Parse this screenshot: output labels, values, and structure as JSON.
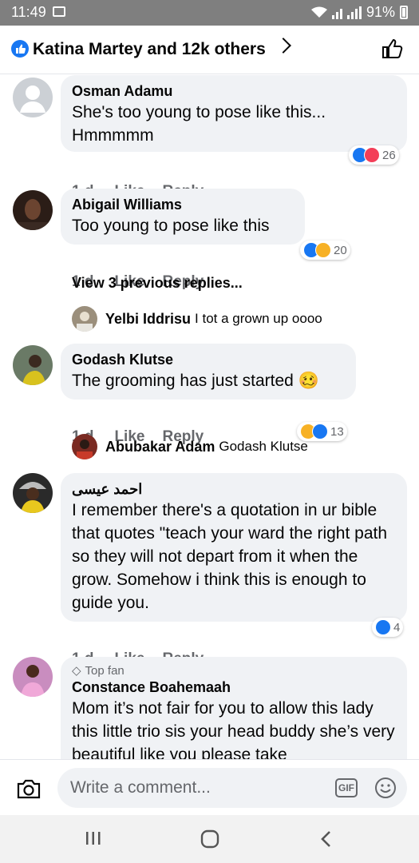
{
  "status": {
    "time": "11:49",
    "battery": "91%"
  },
  "header": {
    "title": "Katina Martey and 12k others"
  },
  "comments": [
    {
      "name": "Osman Adamu",
      "text": "She's too young to pose like this... Hmmmmm",
      "age": "1 d",
      "like": "Like",
      "reply": "Reply",
      "reactions": "26"
    },
    {
      "name": "Abigail Williams",
      "text": "Too young to pose like this",
      "age": "1 d",
      "like": "Like",
      "reply": "Reply",
      "reactions": "20"
    },
    {
      "name": "Godash Klutse",
      "text": "The grooming has just started 🥴",
      "age": "1 d",
      "like": "Like",
      "reply": "Reply",
      "reactions": "13"
    },
    {
      "name": "احمد عيسى",
      "text": "I remember there's a quotation in ur bible that quotes \"teach your ward the right path so they will not depart from it when the grow. Somehow i think this is enough to  guide you.",
      "age": "1 d",
      "like": "Like",
      "reply": "Reply",
      "reactions": "4"
    },
    {
      "badge": "Top fan",
      "name": "Constance Boahemaah",
      "text": "Mom it’s not fair for you to allow this lady this little trio sis your head buddy she’s very beautiful like you please take"
    }
  ],
  "view_previous": "View 3 previous replies...",
  "replies": [
    {
      "name": "Yelbi Iddrisu",
      "text": "I tot a grown up oooo"
    },
    {
      "name": "Abubakar Adam",
      "text": "Godash Klutse"
    }
  ],
  "composer": {
    "placeholder": "Write a comment...",
    "gif_label": "GIF"
  },
  "colors": {
    "accent": "#1877f2",
    "bubble": "#f0f2f5",
    "love": "#f33e58",
    "haha": "#f7b125"
  }
}
